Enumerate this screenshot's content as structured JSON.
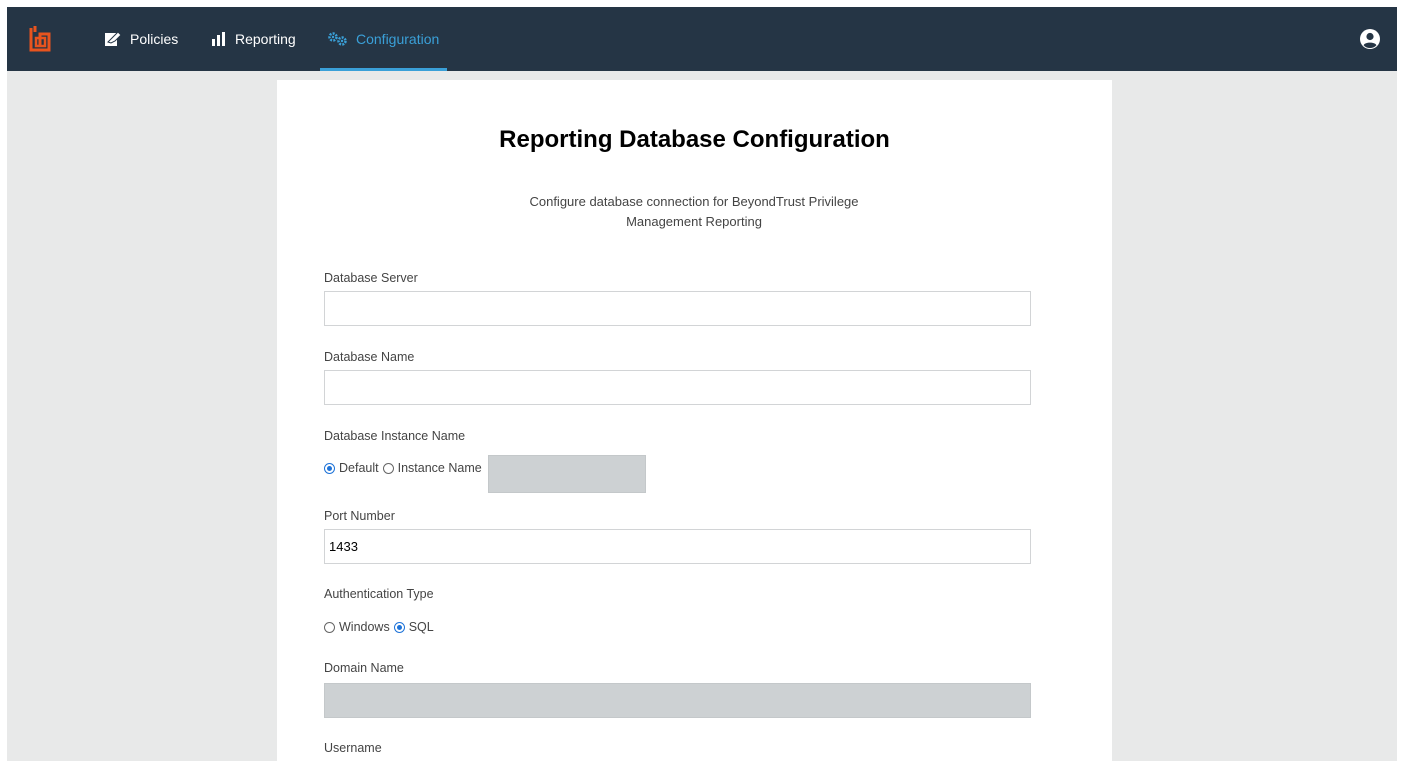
{
  "nav": {
    "items": [
      {
        "label": "Policies",
        "icon": "policies-icon"
      },
      {
        "label": "Reporting",
        "icon": "bar-chart-icon"
      },
      {
        "label": "Configuration",
        "icon": "gears-icon",
        "active": true
      }
    ]
  },
  "colors": {
    "topbar": "#253545",
    "accent": "#3aa0d8",
    "logo": "#e8541e",
    "radio_checked": "#1e73d8"
  },
  "form": {
    "title": "Reporting Database Configuration",
    "subtitle": "Configure database connection for BeyondTrust Privilege Management Reporting",
    "database_server": {
      "label": "Database Server",
      "value": ""
    },
    "database_name": {
      "label": "Database Name",
      "value": ""
    },
    "instance": {
      "label": "Database Instance Name",
      "options": [
        "Default",
        "Instance Name"
      ],
      "selected": "Default",
      "value": ""
    },
    "port": {
      "label": "Port Number",
      "value": "1433"
    },
    "auth": {
      "label": "Authentication Type",
      "options": [
        "Windows",
        "SQL"
      ],
      "selected": "SQL"
    },
    "domain": {
      "label": "Domain Name",
      "value": ""
    },
    "username": {
      "label": "Username",
      "value": ""
    }
  }
}
